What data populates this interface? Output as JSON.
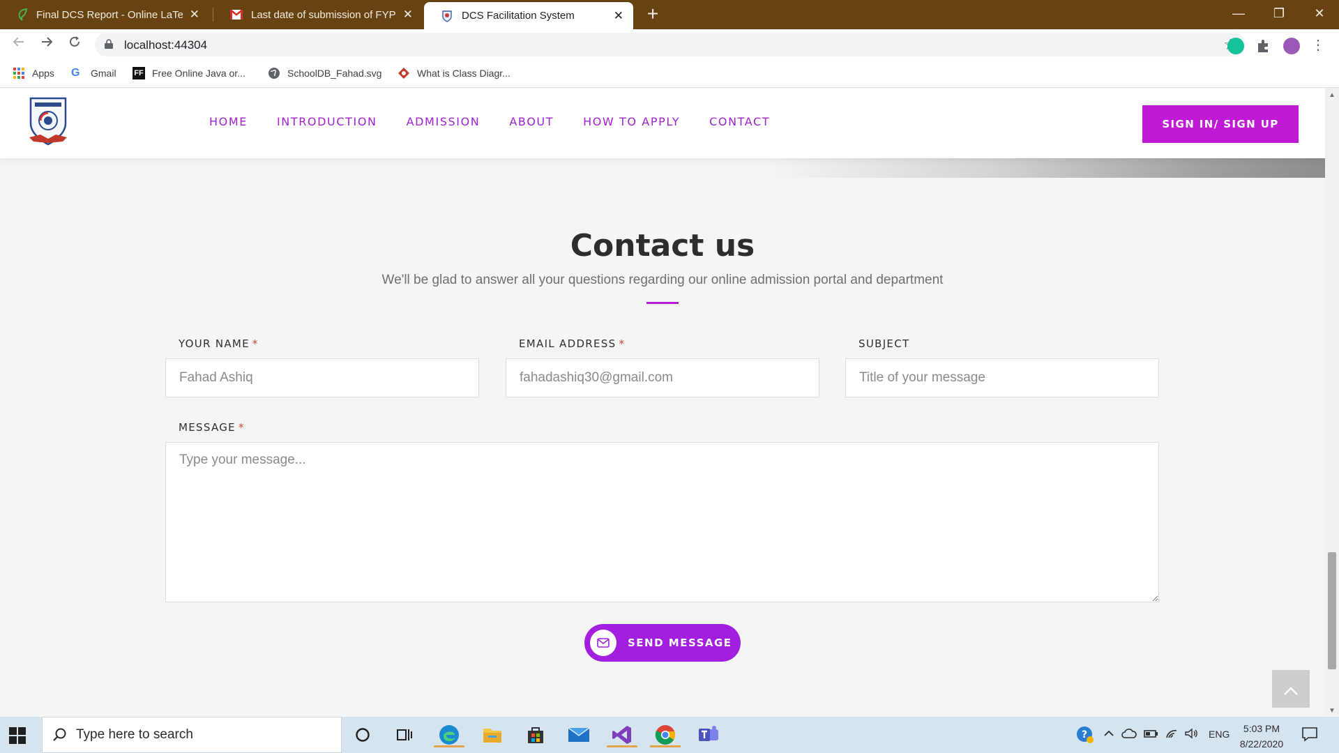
{
  "browser": {
    "tabs": [
      {
        "title": "Final DCS Report - Online LaTeX E",
        "icon": "overleaf-icon"
      },
      {
        "title": "Last date of submission of FYP fo",
        "icon": "gmail-icon"
      },
      {
        "title": "DCS Facilitation System",
        "icon": "site-favicon"
      }
    ],
    "url": "localhost:44304",
    "bookmarks": [
      "Apps",
      "Gmail",
      "Free Online Java or...",
      "SchoolDB_Fahad.svg",
      "What is Class Diagr..."
    ]
  },
  "site": {
    "nav": [
      "HOME",
      "INTRODUCTION",
      "ADMISSION",
      "ABOUT",
      "HOW TO APPLY",
      "CONTACT"
    ],
    "signin_label": "SIGN IN/ SIGN UP",
    "accent_color": "#b21fd0"
  },
  "contact": {
    "title": "Contact us",
    "subtitle": "We'll be glad to answer all your questions regarding our online admission portal and department",
    "name_label": "YOUR NAME",
    "name_value": "Fahad Ashiq",
    "email_label": "EMAIL ADDRESS",
    "email_value": "fahadashiq30@gmail.com",
    "subject_label": "SUBJECT",
    "subject_placeholder": "Title of your message",
    "message_label": "MESSAGE",
    "message_placeholder": "Type your message...",
    "required_mark": "*",
    "send_label": "SEND MESSAGE"
  },
  "taskbar": {
    "search_placeholder": "Type here to search",
    "language": "ENG",
    "time": "5:03 PM",
    "date": "8/22/2020"
  }
}
